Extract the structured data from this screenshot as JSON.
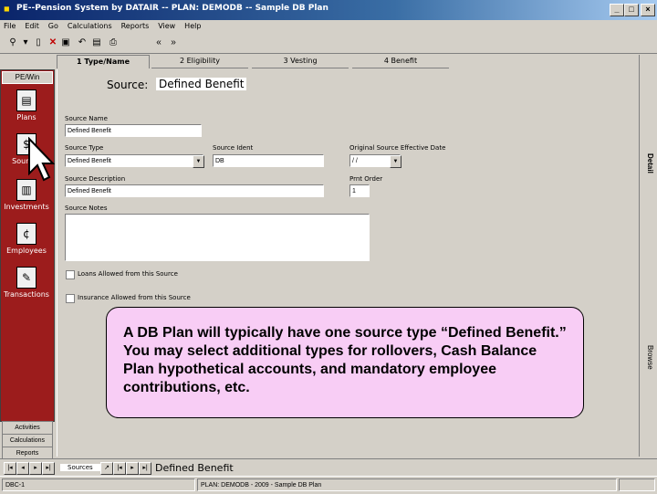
{
  "window": {
    "title": "PE--Pension System by DATAIR -- PLAN: DEMODB -- Sample DB Plan"
  },
  "menu": [
    "File",
    "Edit",
    "Go",
    "Calculations",
    "Reports",
    "View",
    "Help"
  ],
  "toolbar": {
    "back": "«",
    "forward": "»"
  },
  "tabs": [
    "1 Type/Name",
    "2 Eligibility",
    "3 Vesting",
    "4 Benefit"
  ],
  "sidebar": {
    "header": "PE/Win",
    "items": [
      {
        "label": "Plans",
        "icon": "plans-icon"
      },
      {
        "label": "Sources",
        "icon": "sources-icon"
      },
      {
        "label": "Investments",
        "icon": "investments-icon"
      },
      {
        "label": "Employees",
        "icon": "employees-icon"
      },
      {
        "label": "Transactions",
        "icon": "transactions-icon"
      }
    ],
    "bottom": [
      "Activities",
      "Calculations",
      "Reports"
    ]
  },
  "form": {
    "heading_label": "Source:",
    "heading_value": "Defined Benefit",
    "source_name_label": "Source Name",
    "source_name": "Defined Benefit",
    "source_type_label": "Source Type",
    "source_type": "Defined Benefit",
    "source_ident_label": "Source Ident",
    "source_ident": "DB",
    "orig_date_label": "Original Source Effective Date",
    "orig_date": "/ /",
    "source_desc_label": "Source Description",
    "source_desc": "Defined Benefit",
    "print_order_label": "Prnt Order",
    "print_order": "1",
    "source_notes_label": "Source Notes",
    "loans_label": "Loans Allowed from this Source",
    "insurance_label": "Insurance Allowed from this Source"
  },
  "right_strip": {
    "detail": "Detail",
    "browse": "Browse"
  },
  "callout": "A DB Plan will typically have one source type “Defined Benefit.”  You may select additional types for rollovers, Cash Balance Plan hypothetical accounts, and mandatory employee contributions, etc.",
  "navbar": {
    "tab_label": "Sources",
    "record_label": "Defined Benefit"
  },
  "status": {
    "left": "DBC-1",
    "center": "PLAN: DEMODB - 2009 - Sample DB Plan"
  }
}
